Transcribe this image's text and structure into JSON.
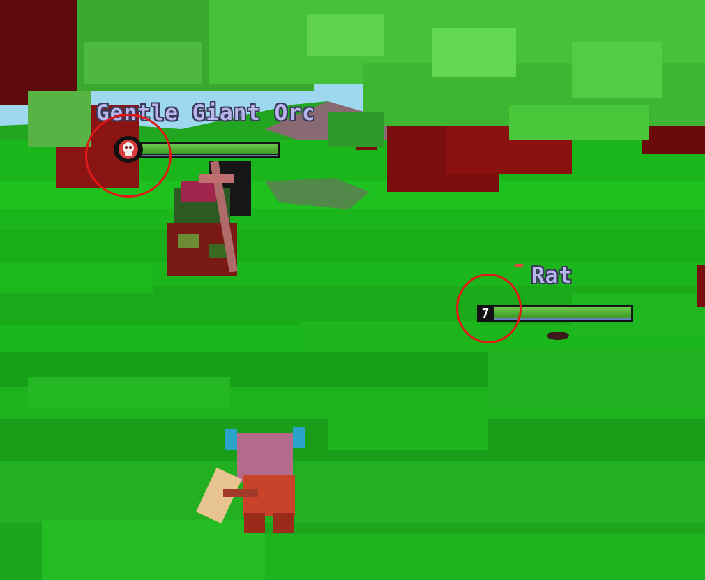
{
  "enemies": {
    "boss": {
      "name": "Gentle Giant Orc",
      "health_fraction": 1.0,
      "badge_icon": "skull-icon"
    },
    "rat": {
      "name": "Rat",
      "level": "7",
      "health_fraction": 1.0
    }
  },
  "colors": {
    "grass": "#19b419",
    "foliage": "#3fc23a",
    "trunk": "#7a0d0d",
    "health": "#4caf33",
    "highlight_circle": "#e01818",
    "name_text": "#b9b6ec"
  }
}
